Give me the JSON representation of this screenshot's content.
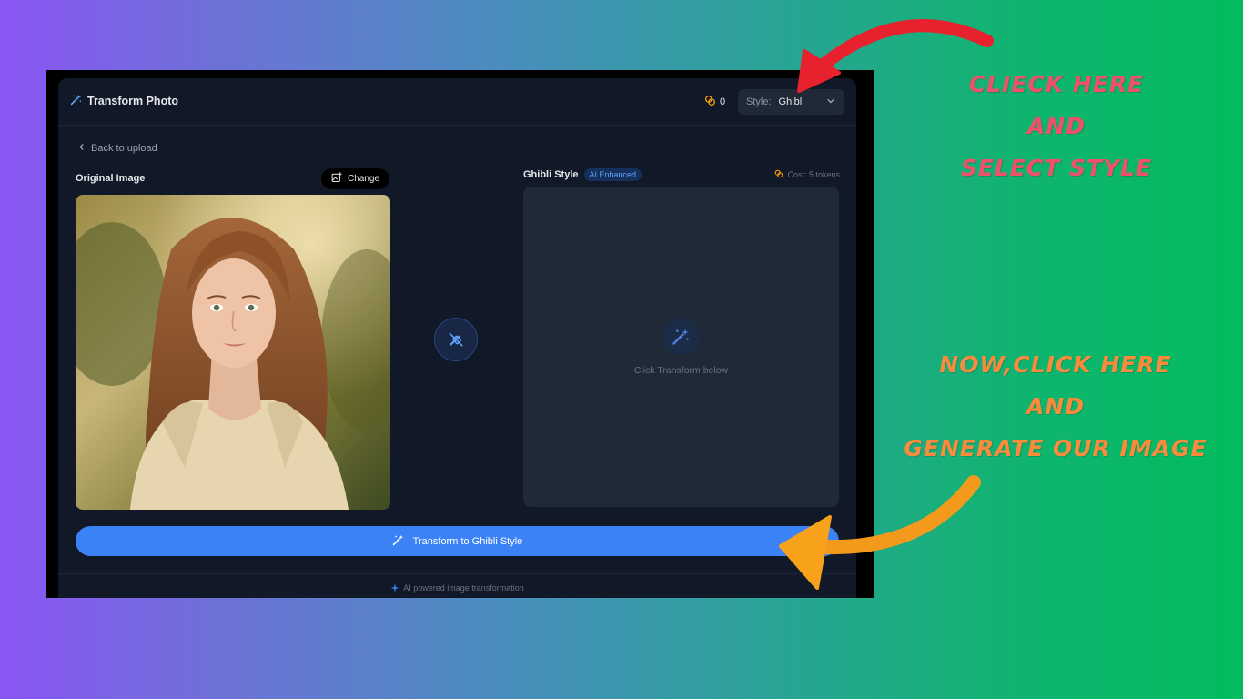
{
  "app": {
    "title": "Transform Photo",
    "token_count": "0",
    "style_label": "Style:",
    "style_value": "Ghibli"
  },
  "nav": {
    "back_label": "Back to upload"
  },
  "original": {
    "label": "Original Image",
    "change_label": "Change"
  },
  "result": {
    "title": "Ghibli Style",
    "badge": "AI Enhanced",
    "cost": "Cost: 5 tokens",
    "hint": "Click Transform below"
  },
  "action": {
    "transform_label": "Transform to Ghibli Style"
  },
  "footer": {
    "text": "AI powered image transformation"
  },
  "annotations": {
    "top_lines": [
      "CLIECK HERE",
      "AND",
      "SELECT STYLE"
    ],
    "bottom_lines": [
      "NOW,CLICK HERE",
      "AND",
      "GENERATE OUR IMAGE"
    ]
  },
  "colors": {
    "accent": "#3b82f6",
    "panel": "#111827",
    "annot_top": "#f0506a",
    "annot_bottom": "#fb8a3c",
    "arrow_red": "#e8212f",
    "arrow_orange": "#f7a21a"
  }
}
